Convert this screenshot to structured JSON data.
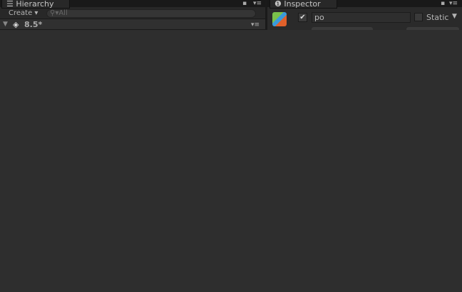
{
  "hierarchy": {
    "tab": "Hierarchy",
    "create": "Create",
    "search_placeholder": "All",
    "scene": "8.5*"
  },
  "inspector": {
    "tab": "Inspector",
    "name_value": "po",
    "static_label": "Static",
    "active": true,
    "static": false
  }
}
